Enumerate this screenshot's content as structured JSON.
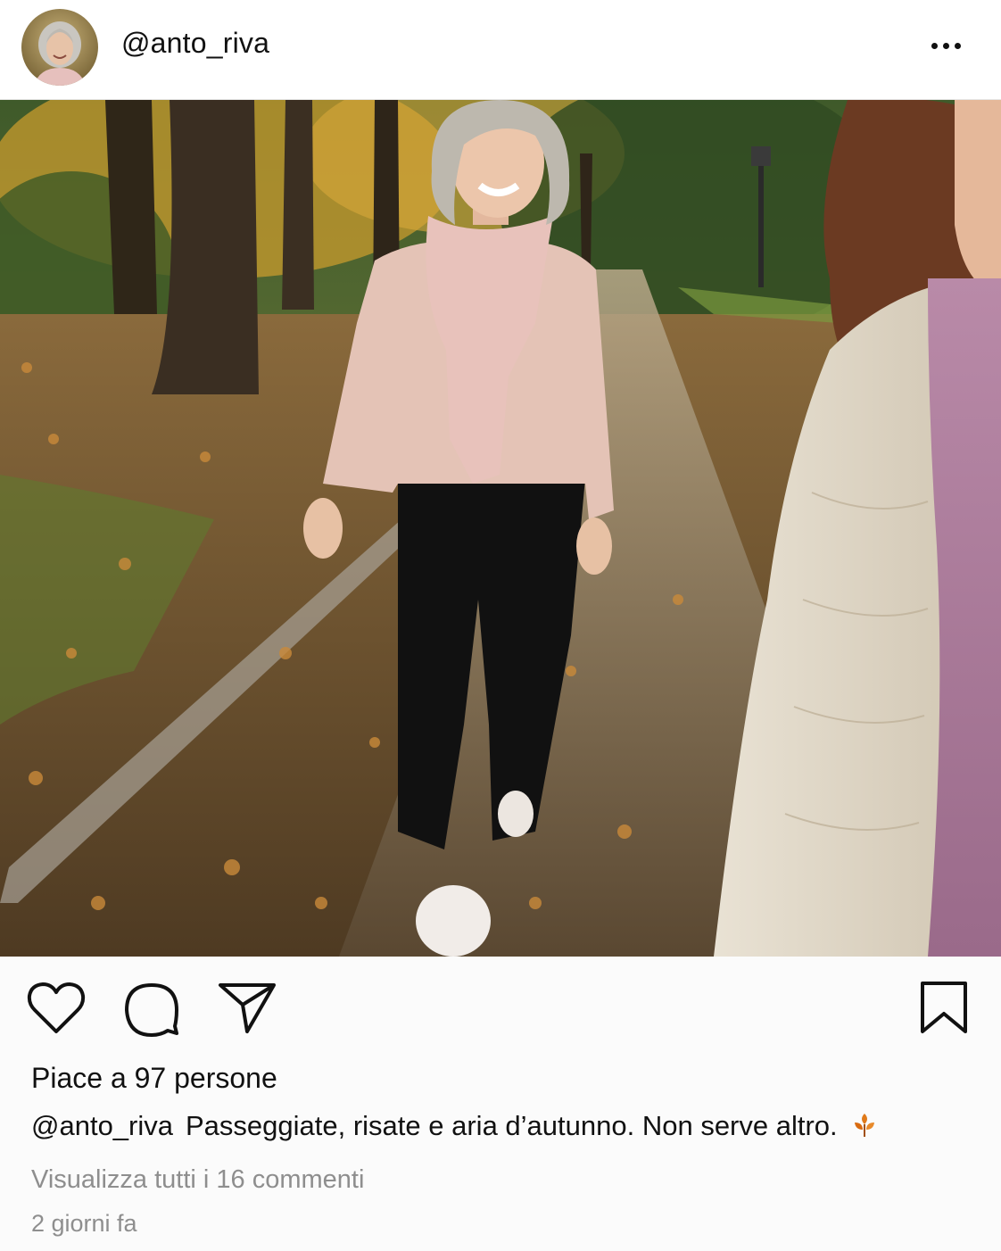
{
  "post": {
    "username": "@anto_riva",
    "likes_text": "Piace a 97 persone",
    "caption_user": "@anto_riva",
    "caption_text": "Passeggiate, risate e aria d’autunno. Non serve altro.",
    "view_comments_text": "Visualizza tutti i 16 commenti",
    "timestamp": "2 giorni fa"
  },
  "icons": {
    "more": "more-options-icon",
    "like": "heart-icon",
    "comment": "comment-bubble-icon",
    "share": "send-icon",
    "save": "bookmark-icon",
    "emoji": "autumn-leaf-icon"
  },
  "colors": {
    "text": "#111111",
    "muted": "#8e8e8e",
    "leaf": "#e07a1a"
  }
}
